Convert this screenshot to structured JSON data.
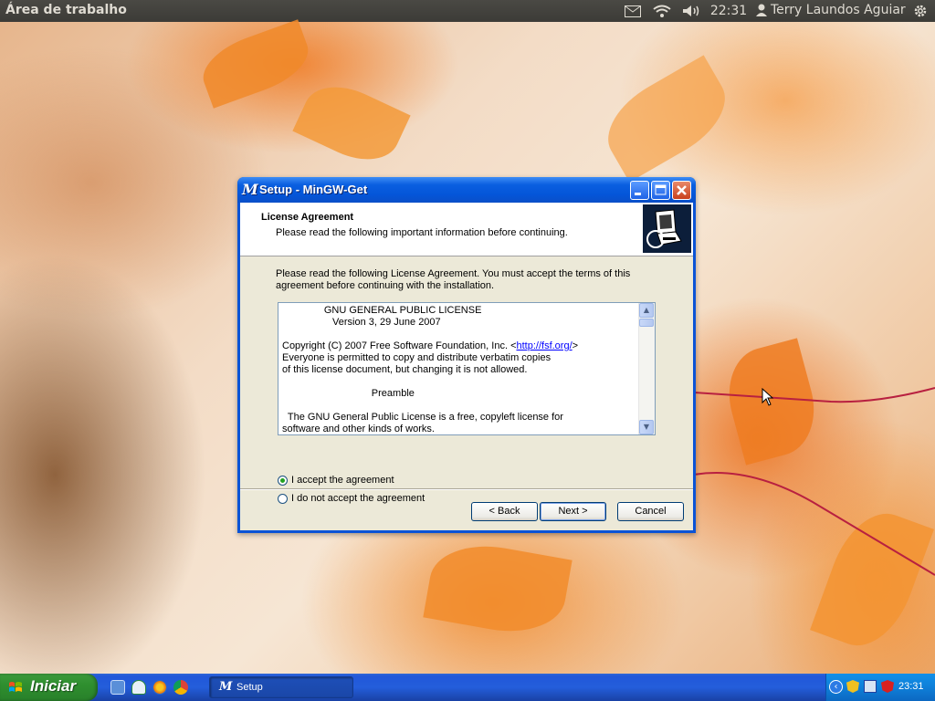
{
  "top_panel": {
    "title": "Área de trabalho",
    "time": "22:31",
    "user": "Terry Laundos Aguiar",
    "icons": [
      "mail-icon",
      "wifi-icon",
      "volume-icon",
      "user-icon",
      "gear-icon"
    ]
  },
  "dialog": {
    "title": "Setup - MinGW-Get",
    "app_icon": "M",
    "header_title": "License Agreement",
    "header_subtitle": "Please read the following important information before continuing.",
    "instructions": "Please read the following License Agreement. You must accept the terms of this agreement before continuing with the installation.",
    "license": {
      "line1": "               GNU GENERAL PUBLIC LICENSE",
      "line2": "                  Version 3, 29 June 2007",
      "line3": "Copyright (C) 2007 Free Software Foundation, Inc. <",
      "link": "http://fsf.org/",
      "line3_end": ">",
      "line4": "Everyone is permitted to copy and distribute verbatim copies",
      "line5": "of this license document, but changing it is not allowed.",
      "line6": "                                Preamble",
      "line7": "  The GNU General Public License is a free, copyleft license for",
      "line8": "software and other kinds of works."
    },
    "radio_accept": "I accept the agreement",
    "radio_decline": "I do not accept the agreement",
    "selected_option": "accept",
    "buttons": {
      "back": "< Back",
      "next": "Next >",
      "cancel": "Cancel"
    }
  },
  "taskbar": {
    "start_label": "Iniciar",
    "task_label": "Setup",
    "clock": "23:31"
  }
}
